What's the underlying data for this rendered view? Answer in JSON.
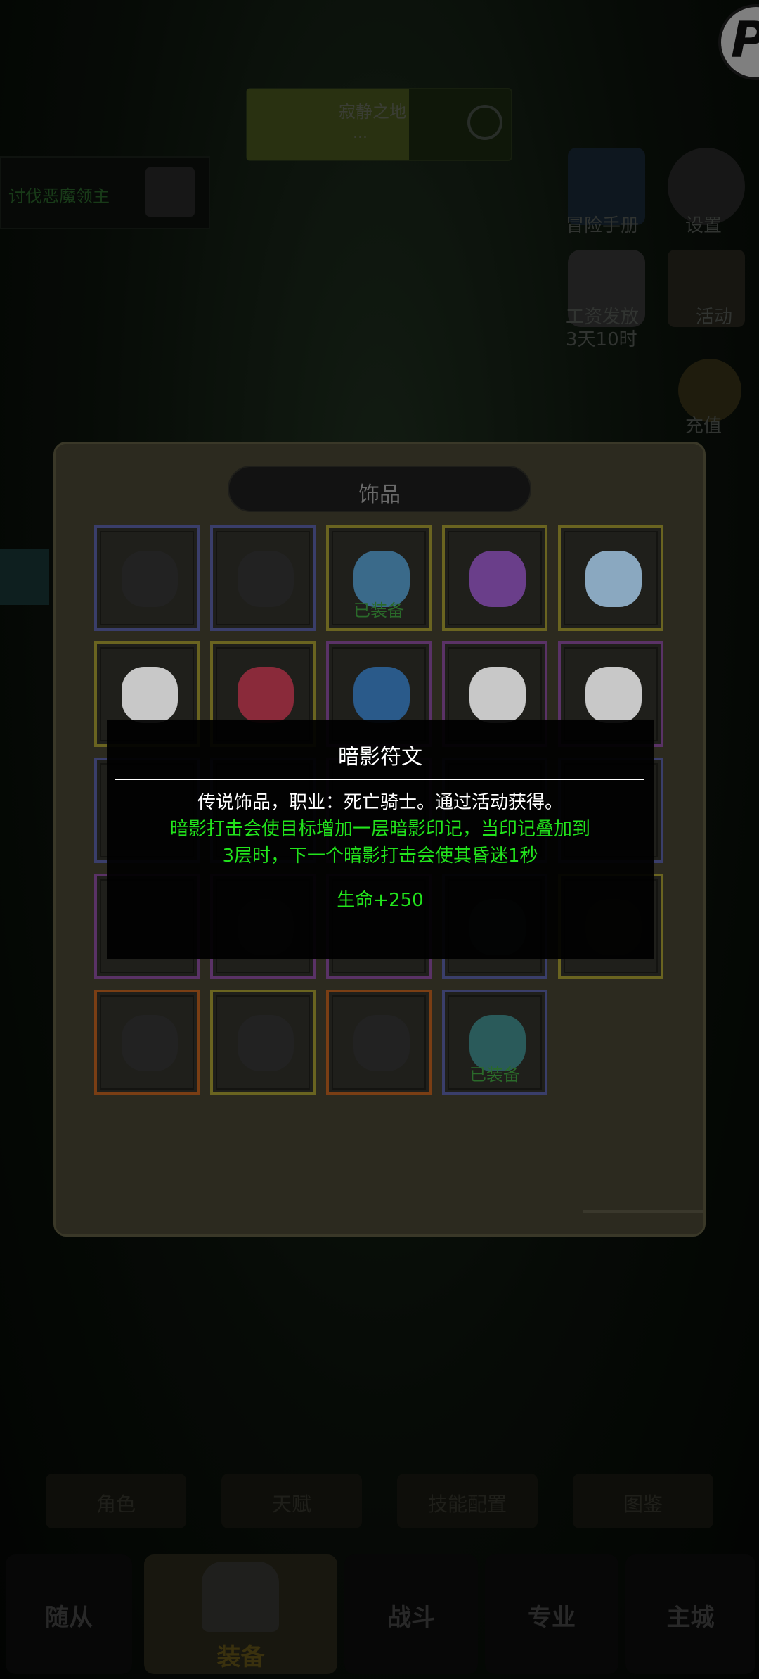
{
  "background": {
    "map_name": "寂静之地",
    "map_sub": "...",
    "task_text": "讨伐恶魔领主",
    "side_labels": [
      "冒险手册",
      "设置",
      "工资发放",
      "3天10时",
      "活动",
      "充值"
    ]
  },
  "panel": {
    "title": "饰品",
    "slots": [
      {
        "rarity": "blue",
        "color": "#222",
        "equipped": ""
      },
      {
        "rarity": "blue",
        "color": "#222",
        "equipped": ""
      },
      {
        "rarity": "yellow",
        "color": "#3a6a8a",
        "equipped": "已装备"
      },
      {
        "rarity": "yellow",
        "color": "#6a3e8a",
        "equipped": ""
      },
      {
        "rarity": "yellow",
        "color": "#8aa8c0",
        "equipped": ""
      },
      {
        "rarity": "yellow",
        "color": "#c8c8c8",
        "equipped": ""
      },
      {
        "rarity": "yellow",
        "color": "#8a2a3a",
        "equipped": ""
      },
      {
        "rarity": "purple",
        "color": "#2a5a8a",
        "equipped": ""
      },
      {
        "rarity": "purple",
        "color": "#c8c8c8",
        "equipped": ""
      },
      {
        "rarity": "purple",
        "color": "#c8c8c8",
        "equipped": ""
      },
      {
        "rarity": "blue",
        "color": "#222",
        "equipped": ""
      },
      {
        "rarity": "blue",
        "color": "#222",
        "equipped": ""
      },
      {
        "rarity": "purple",
        "color": "#222",
        "equipped": ""
      },
      {
        "rarity": "blue",
        "color": "#222",
        "equipped": ""
      },
      {
        "rarity": "blue",
        "color": "#222",
        "equipped": ""
      },
      {
        "rarity": "purple",
        "color": "#222",
        "equipped": ""
      },
      {
        "rarity": "purple",
        "color": "#2a2a2a",
        "equipped": ""
      },
      {
        "rarity": "purple",
        "color": "#222",
        "equipped": ""
      },
      {
        "rarity": "blue",
        "color": "#2a3a3a",
        "equipped": ""
      },
      {
        "rarity": "yellow",
        "color": "#2a2a22",
        "equipped": ""
      },
      {
        "rarity": "orange",
        "color": "#222",
        "equipped": ""
      },
      {
        "rarity": "yellow",
        "color": "#222",
        "equipped": ""
      },
      {
        "rarity": "orange",
        "color": "#222",
        "equipped": ""
      },
      {
        "rarity": "blue",
        "color": "#2a5a5a",
        "equipped": "已装备"
      }
    ]
  },
  "tooltip": {
    "title": "暗影符文",
    "description": "传说饰品，职业：死亡骑士。通过活动获得。",
    "effect_line1": "暗影打击会使目标增加一层暗影印记，当印记叠加到",
    "effect_line2": "3层时，下一个暗影打击会使其昏迷1秒",
    "stat": "生命+250",
    "effect_color": "#22e41c"
  },
  "bottom_tabs": [
    "角色",
    "天赋",
    "技能配置",
    "图鉴"
  ],
  "nav": [
    "随从",
    "装备",
    "战斗",
    "专业",
    "主城"
  ],
  "nav_active": "装备"
}
